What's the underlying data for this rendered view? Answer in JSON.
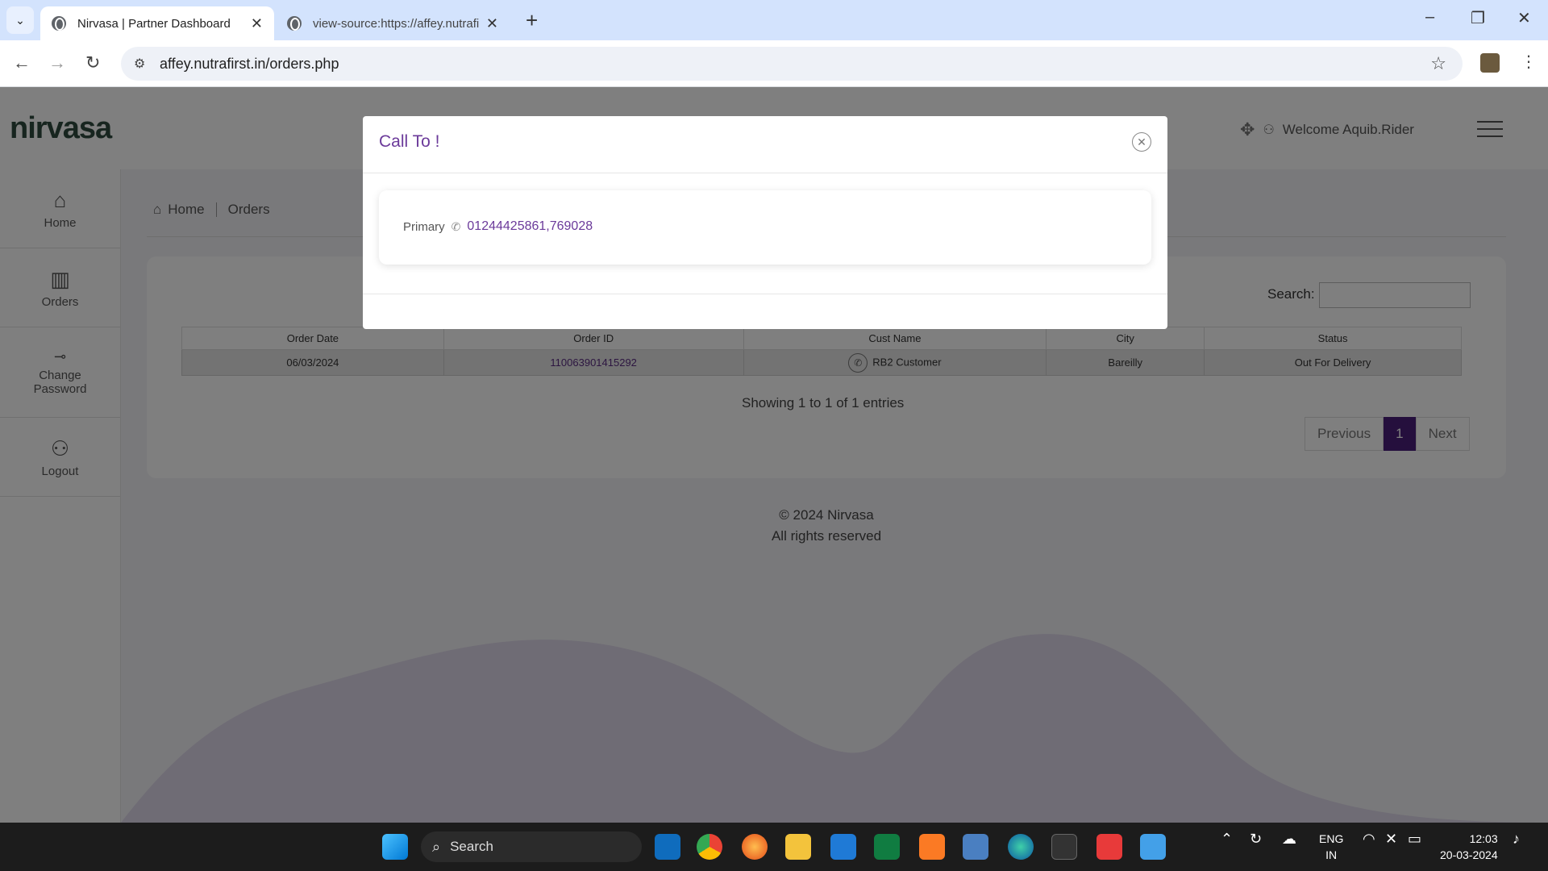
{
  "browser": {
    "tabs": [
      {
        "title": "Nirvasa | Partner Dashboard",
        "active": true
      },
      {
        "title": "view-source:https://affey.nutrafirst.in",
        "active": false
      }
    ],
    "url": "affey.nutrafirst.in/orders.php",
    "new_tab": "+",
    "window_controls": [
      "–",
      "❐",
      "✕"
    ]
  },
  "header": {
    "logo": "nirvasa",
    "welcome": "Welcome Aquib.Rider"
  },
  "sidebar": {
    "items": [
      {
        "label": "Home",
        "icon": "home-icon"
      },
      {
        "label": "Orders",
        "icon": "chart-icon"
      },
      {
        "label": "Change Password",
        "icon": "key-icon"
      },
      {
        "label": "Logout",
        "icon": "user-icon"
      }
    ]
  },
  "breadcrumb": {
    "home": "Home",
    "current": "Orders"
  },
  "table": {
    "search_label": "Search:",
    "search_value": "",
    "columns": [
      "Order Date",
      "Order ID",
      "Cust Name",
      "City",
      "Status"
    ],
    "rows": [
      {
        "order_date": "06/03/2024",
        "order_id": "110063901415292",
        "cust_name": "RB2 Customer",
        "city": "Bareilly",
        "status": "Out For Delivery"
      }
    ],
    "showing": "Showing 1 to 1 of 1 entries",
    "pagination": {
      "previous": "Previous",
      "current": "1",
      "next": "Next"
    }
  },
  "footer": {
    "copyright": "© 2024 Nirvasa",
    "rights": "All rights reserved"
  },
  "modal": {
    "title": "Call To !",
    "label": "Primary",
    "number": "01244425861,769028"
  },
  "taskbar": {
    "search_placeholder": "Search",
    "lang_top": "ENG",
    "lang_bottom": "IN",
    "time": "12:03",
    "date": "20-03-2024"
  },
  "colors": {
    "accent": "#4b1e7a",
    "modal_title": "#6b3a9a",
    "logo": "#2e4a3e"
  }
}
